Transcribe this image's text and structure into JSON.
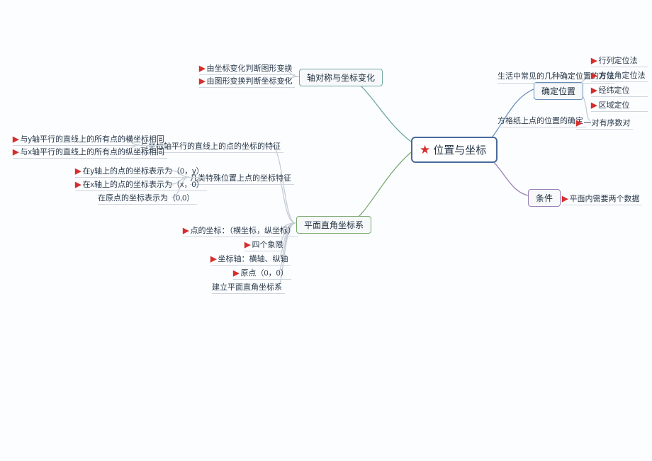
{
  "center": {
    "title": "位置与坐标"
  },
  "right": {
    "determine": {
      "label": "确定位置",
      "sub1": {
        "label": "生活中常见的几种确定位置的方法",
        "leaves": [
          "行列定位法",
          "方位角定位法",
          "经纬定位",
          "区域定位"
        ]
      },
      "sub2": {
        "label": "方格纸上点的位置的确定",
        "leaves": [
          "一对有序数对"
        ]
      }
    },
    "condition": {
      "label": "条件",
      "leaf": "平面内需要两个数据"
    }
  },
  "left": {
    "axis": {
      "label": "轴对称与坐标变化",
      "leaves": [
        "由坐标变化判断图形变换",
        "由图形变换判断坐标变化"
      ]
    },
    "coord": {
      "label": "平面直角坐标系",
      "parallel": {
        "label": "与坐标轴平行的直线上的点的坐标的特征",
        "leaves": [
          "与y轴平行的直线上的所有点的横坐标相同",
          "与x轴平行的直线上的所有点的纵坐标相同"
        ]
      },
      "special": {
        "label": "几类特殊位置上点的坐标特征",
        "leaves": [
          "在y轴上的点的坐标表示为（0，y）",
          "在x轴上的点的坐标表示为（x，0）",
          "在原点的坐标表示为（0,0）"
        ]
      },
      "others": [
        "点的坐标：（横坐标，纵坐标）",
        "四个象限",
        "坐标轴：横轴、纵轴",
        "原点（0，0）",
        "建立平面直角坐标系"
      ]
    }
  }
}
